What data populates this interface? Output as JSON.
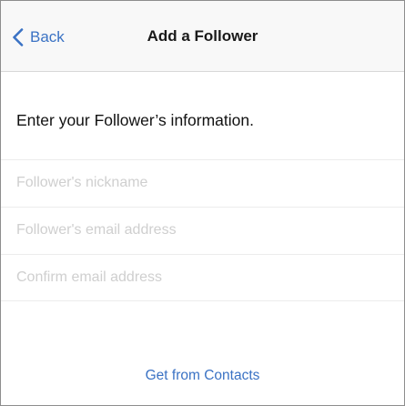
{
  "nav": {
    "back_label": "Back",
    "back_icon": "chevron-left-icon",
    "title": "Add a Follower"
  },
  "main": {
    "instruction": "Enter your Follower’s information.",
    "fields": [
      {
        "placeholder": "Follower's nickname",
        "value": ""
      },
      {
        "placeholder": "Follower's email address",
        "value": ""
      },
      {
        "placeholder": "Confirm email address",
        "value": ""
      }
    ],
    "contacts_link": "Get from Contacts"
  },
  "colors": {
    "accent": "#3a72c4",
    "nav_background": "#f8f8f8",
    "placeholder": "#cfcfcf"
  }
}
